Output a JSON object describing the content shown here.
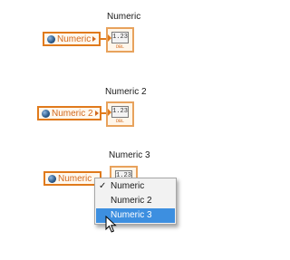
{
  "blocks": [
    {
      "label": "Numeric",
      "local_name": "Numeric",
      "show_arrow": true,
      "terminal_text": "1.23",
      "terminal_type": "DBL"
    },
    {
      "label": "Numeric 2",
      "local_name": "Numeric 2",
      "show_arrow": true,
      "terminal_text": "1.23",
      "terminal_type": "DBL"
    },
    {
      "label": "Numeric 3",
      "local_name": "Numeric",
      "show_arrow": false,
      "terminal_text": "1.23",
      "terminal_type": ""
    }
  ],
  "menu": {
    "items": [
      {
        "label": "Numeric",
        "checked": true,
        "selected": false
      },
      {
        "label": "Numeric 2",
        "checked": false,
        "selected": false
      },
      {
        "label": "Numeric 3",
        "checked": false,
        "selected": true
      }
    ],
    "check_glyph": "✓"
  },
  "colors": {
    "wire": "#e07a1c",
    "terminal_border": "#e8a25c",
    "menu_highlight": "#3d8fe0"
  },
  "icons": [
    "globe-icon",
    "terminal-arrow-icon",
    "mouse-pointer-icon"
  ]
}
